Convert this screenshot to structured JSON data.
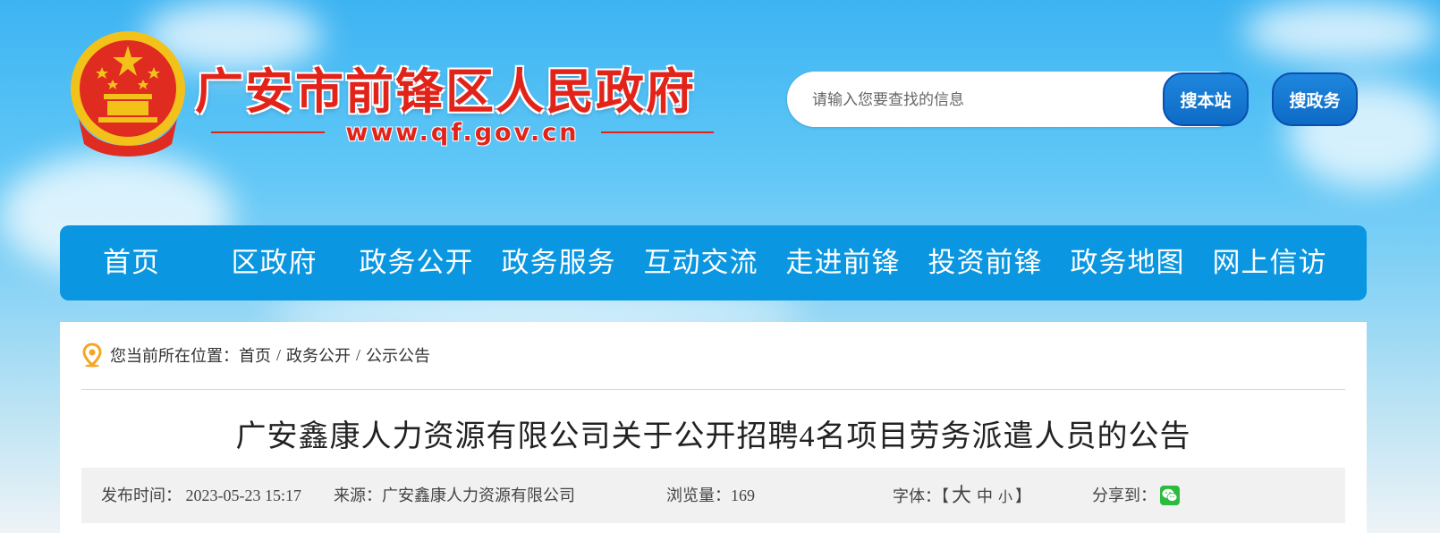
{
  "header": {
    "site_title": "广安市前锋区人民政府",
    "site_url": "www.qf.gov.cn",
    "search_placeholder": "请输入您要查找的信息",
    "search_site_label": "搜本站",
    "search_gov_label": "搜政务"
  },
  "nav": {
    "items": [
      "首页",
      "区政府",
      "政务公开",
      "政务服务",
      "互动交流",
      "走进前锋",
      "投资前锋",
      "政务地图",
      "网上信访"
    ]
  },
  "breadcrumb": {
    "prefix": "您当前所在位置：",
    "items": [
      "首页",
      "政务公开",
      "公示公告"
    ],
    "separator": "/"
  },
  "article": {
    "title": "广安鑫康人力资源有限公司关于公开招聘4名项目劳务派遣人员的公告",
    "meta": {
      "date_label": "发布时间：",
      "date_value": "2023-05-23 15:17",
      "source_label": "来源：",
      "source_value": "广安鑫康人力资源有限公司",
      "views_label": "浏览量：",
      "views_value": "169",
      "font_label": "字体：",
      "font_open": "【",
      "font_large": "大",
      "font_medium": "中",
      "font_small": "小",
      "font_close": "】",
      "share_label": "分享到："
    }
  },
  "colors": {
    "brand_red": "#e2231a",
    "nav_blue": "#0a96e0",
    "button_blue": "#0d6bc6",
    "wechat_green": "#2dbb3f"
  },
  "icons": [
    "national-emblem-icon",
    "location-pin-icon",
    "wechat-icon"
  ]
}
